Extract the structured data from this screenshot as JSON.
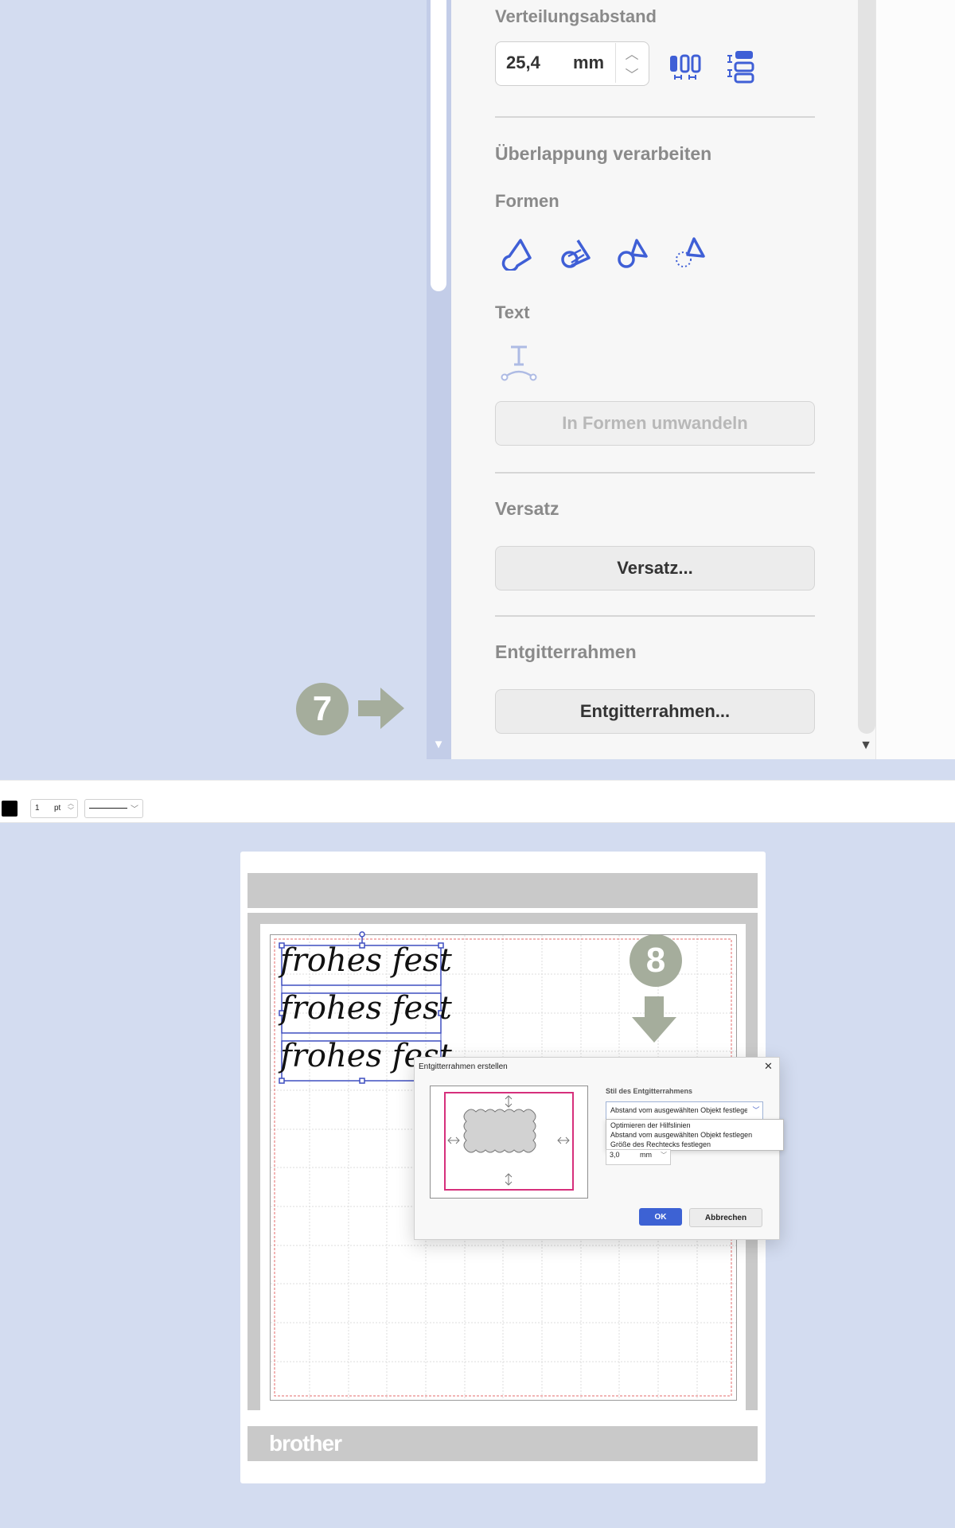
{
  "panel": {
    "distribution_label": "Verteilungsabstand",
    "distribution_value": "25,4",
    "distribution_unit": "mm",
    "overlap_heading": "Überlappung verarbeiten",
    "shapes_label": "Formen",
    "shape_icons": [
      "weld-icon",
      "divide-icon",
      "trim-icon",
      "subtract-icon"
    ],
    "text_label": "Text",
    "text_icon": "text-path-icon",
    "convert_button": "In Formen umwandeln",
    "offset_heading": "Versatz",
    "offset_button": "Versatz...",
    "frame_heading": "Entgitterrahmen",
    "frame_button": "Entgitterrahmen..."
  },
  "steps": {
    "step7": "7",
    "step8": "8"
  },
  "toolbar": {
    "stroke_width": "1",
    "stroke_unit": "pt",
    "color": "#000000"
  },
  "canvas": {
    "text_lines": [
      "frohes fest",
      "frohes fest",
      "frohes fest"
    ],
    "brand": "brother"
  },
  "dialog": {
    "title": "Entgitterrahmen erstellen",
    "style_label": "Stil des Entgitterrahmens",
    "selected_value": "Abstand vom ausgewählten Objekt festlegen",
    "options": [
      "Optimieren der Hilfslinien",
      "Abstand vom ausgewählten Objekt festlegen",
      "Größe des Rechtecks festlegen"
    ],
    "margin_value": "3,0",
    "margin_unit": "mm",
    "ok_label": "OK",
    "cancel_label": "Abbrechen"
  },
  "colors": {
    "accent": "#3d62d4",
    "icon_blue": "#3f5fd6",
    "badge": "#a5ad9c",
    "frame_pink": "#d6307c"
  }
}
